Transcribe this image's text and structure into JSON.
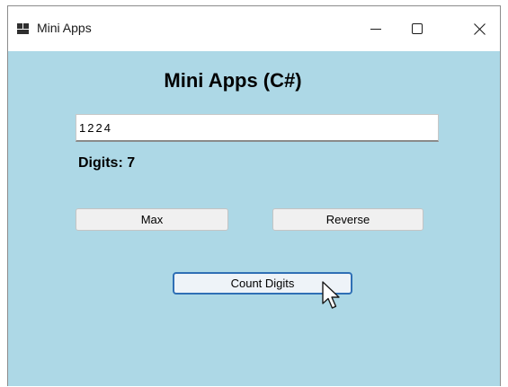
{
  "window": {
    "title": "Mini Apps",
    "controls": {
      "minimize": "—",
      "maximize": "☐",
      "close": "✕"
    }
  },
  "main": {
    "heading": "Mini Apps (C#)",
    "input_value": "1224",
    "result_label": "Digits: 7",
    "buttons": {
      "max": "Max",
      "reverse": "Reverse",
      "count_digits": "Count Digits"
    }
  },
  "colors": {
    "background": "#add8e6",
    "focus_border": "#2f6fb5"
  },
  "icons": [
    "app-icon",
    "minimize-icon",
    "maximize-icon",
    "close-icon",
    "mouse-pointer-icon"
  ]
}
